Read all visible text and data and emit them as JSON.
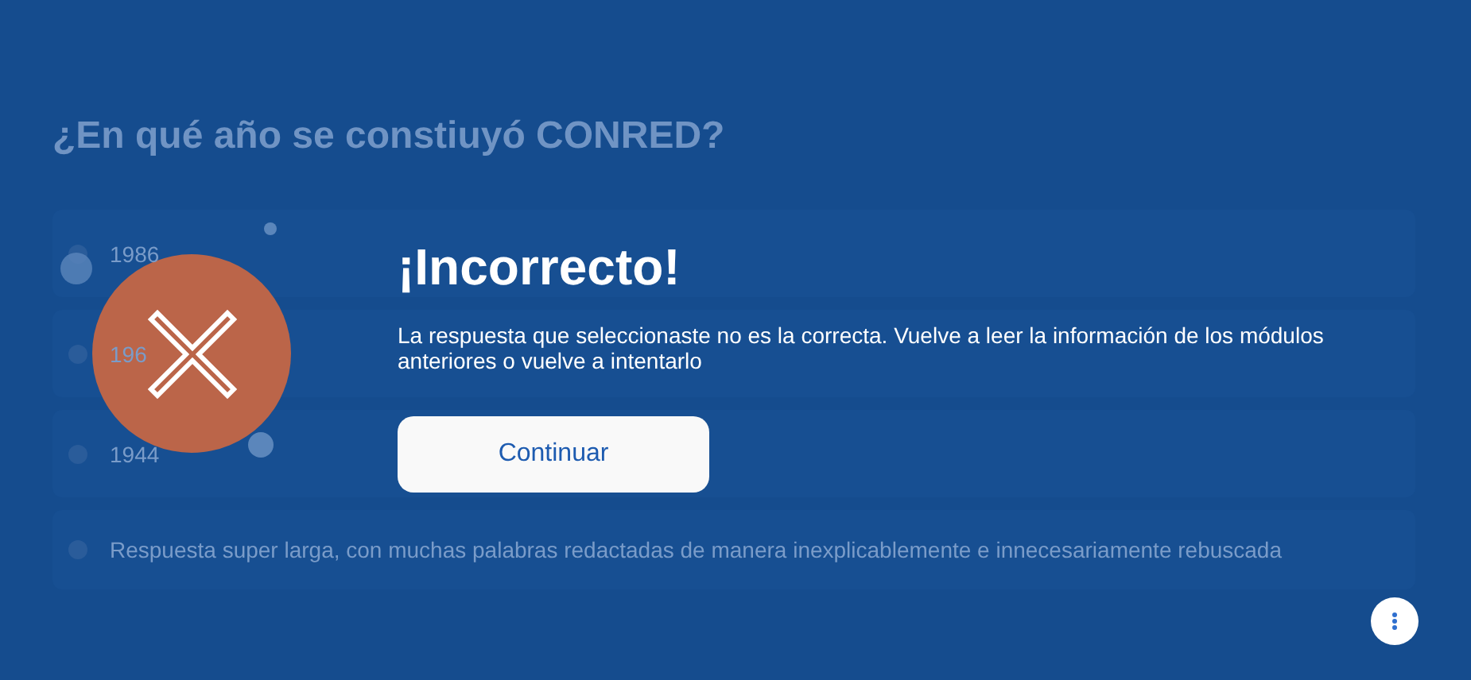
{
  "question": {
    "title": "¿En qué año se constiuyó CONRED?",
    "options": [
      {
        "label": "1986"
      },
      {
        "label": "196"
      },
      {
        "label": "1944"
      },
      {
        "label": "Respuesta super larga, con muchas palabras redactadas de manera inexplicablemente e innecesariamente rebuscada"
      }
    ]
  },
  "dialog": {
    "title": "¡Incorrecto!",
    "message": "La respuesta que seleccionaste no es la correcta. Vuelve a leer la información de los módulos anteriores o vuelve a intentarlo",
    "button": "Continuar"
  }
}
